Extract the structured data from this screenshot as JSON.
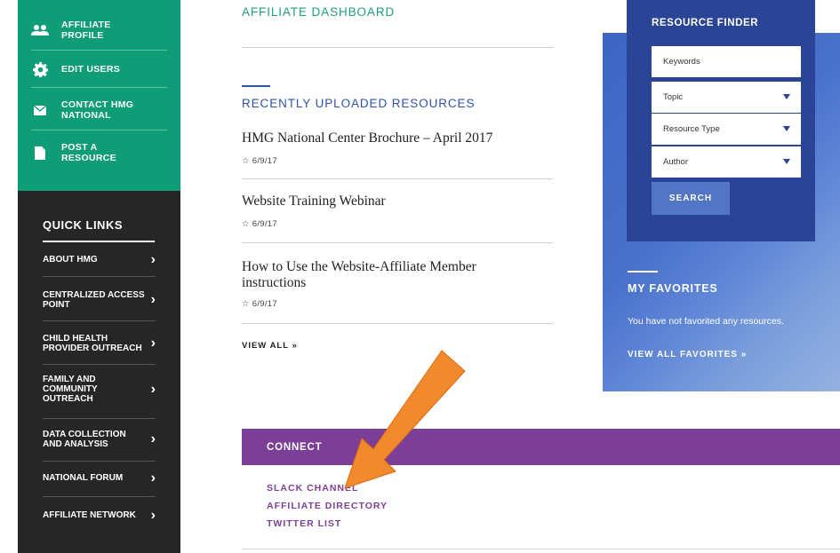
{
  "sidebar": {
    "profile_items": [
      {
        "icon": "users-icon",
        "label_line1": "AFFILIATE",
        "label_line2": "PROFILE"
      },
      {
        "icon": "gear-icon",
        "label_line1": "EDIT USERS",
        "label_line2": ""
      },
      {
        "icon": "envelope-icon",
        "label_line1": "CONTACT HMG",
        "label_line2": "NATIONAL"
      },
      {
        "icon": "document-icon",
        "label_line1": "POST A",
        "label_line2": "RESOURCE"
      }
    ],
    "quick_links_title": "QUICK LINKS",
    "quick_links": [
      {
        "lines": [
          "ABOUT HMG"
        ]
      },
      {
        "lines": [
          "CENTRALIZED ACCESS",
          "POINT"
        ]
      },
      {
        "lines": [
          "CHILD HEALTH",
          "PROVIDER OUTREACH"
        ]
      },
      {
        "lines": [
          "FAMILY AND",
          "COMMUNITY",
          "OUTREACH"
        ]
      },
      {
        "lines": [
          "DATA COLLECTION",
          "AND ANALYSIS"
        ]
      },
      {
        "lines": [
          "NATIONAL FORUM"
        ]
      },
      {
        "lines": [
          "AFFILIATE NETWORK"
        ]
      }
    ],
    "chevron": "›"
  },
  "main": {
    "heading": "AFFILIATE DASHBOARD",
    "recent_title": "RECENTLY UPLOADED RESOURCES",
    "resources": [
      {
        "title_line1": "HMG National Center Brochure – April 2017",
        "title_line2": "",
        "date": "☆ 6/9/17"
      },
      {
        "title_line1": "Website Training Webinar",
        "title_line2": "",
        "date": "☆ 6/9/17"
      },
      {
        "title_line1": "How to Use the Website-Affiliate Member",
        "title_line2": "instructions",
        "date": "☆ 6/9/17"
      }
    ],
    "view_all": "VIEW ALL »"
  },
  "resource_finder": {
    "title": "RESOURCE FINDER",
    "keywords_placeholder": "Keywords",
    "topic": "Topic",
    "resource_type": "Resource Type",
    "author": "Author",
    "search_label": "SEARCH"
  },
  "favorites": {
    "title": "MY FAVORITES",
    "empty_text": "You have not favorited any resources.",
    "view_all": "VIEW ALL FAVORITES »"
  },
  "connect": {
    "title": "CONNECT",
    "links": [
      "SLACK CHANNEL",
      "AFFILIATE DIRECTORY",
      "TWITTER LIST"
    ]
  },
  "colors": {
    "green": "#0f9d78",
    "dark": "#262626",
    "navy": "#2a4596",
    "purple": "#7c3f98",
    "orange_arrow": "#f08a2c"
  }
}
